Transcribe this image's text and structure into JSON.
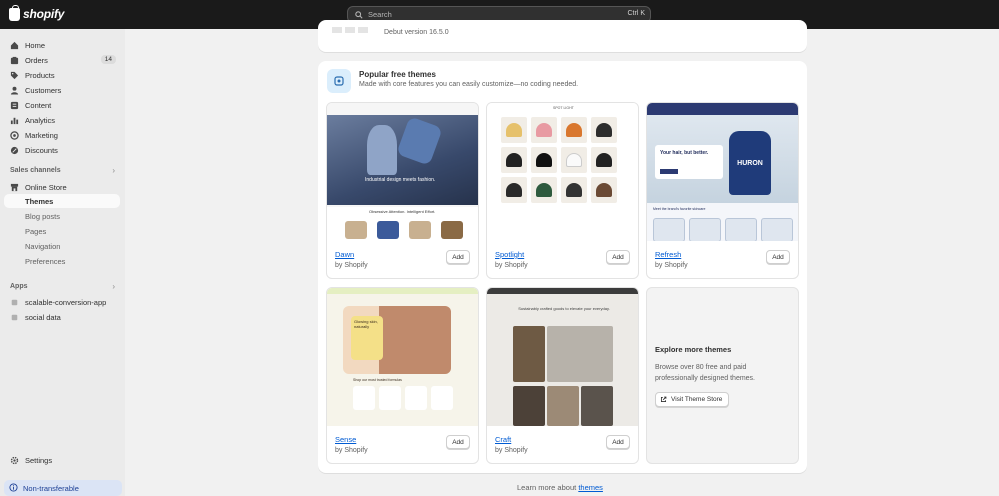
{
  "topbar": {
    "brand": "shopify",
    "search_placeholder": "Search",
    "search_shortcut": "Ctrl K"
  },
  "sidebar": {
    "items": [
      {
        "label": "Home",
        "icon": "home-icon"
      },
      {
        "label": "Orders",
        "icon": "orders-icon",
        "badge": "14"
      },
      {
        "label": "Products",
        "icon": "tag-icon"
      },
      {
        "label": "Customers",
        "icon": "person-icon"
      },
      {
        "label": "Content",
        "icon": "content-icon"
      },
      {
        "label": "Analytics",
        "icon": "chart-icon"
      },
      {
        "label": "Marketing",
        "icon": "target-icon"
      },
      {
        "label": "Discounts",
        "icon": "discount-icon"
      }
    ],
    "sales_channels_label": "Sales channels",
    "online_store": "Online Store",
    "sub_items": [
      "Themes",
      "Blog posts",
      "Pages",
      "Navigation",
      "Preferences"
    ],
    "apps_label": "Apps",
    "apps": [
      "scalable-conversion-app",
      "social data"
    ],
    "settings": "Settings",
    "non_transferable": "Non-transferable"
  },
  "current_theme": {
    "version": "Debut version 16.5.0"
  },
  "popular": {
    "title": "Popular free themes",
    "subtitle": "Made with core features you can easily customize—no coding needed.",
    "add_label": "Add",
    "by_label": "by Shopify",
    "themes": [
      {
        "name": "Dawn",
        "preview_text": "Industrial design meets fashion.",
        "strip_text": "Obsessive Attention. Intelligent Effort."
      },
      {
        "name": "Spotlight",
        "preview_text": "SPOT LIGHT"
      },
      {
        "name": "Refresh",
        "preview_text": "Your hair, but better.",
        "bottle_text": "HURON",
        "section_text": "Meet the brand's favorite skincare"
      },
      {
        "name": "Sense",
        "preview_text": "Glowing skin, naturally",
        "section_text": "Shop our most trusted formulas"
      },
      {
        "name": "Craft",
        "preview_text": "Sustainably crafted goods to elevate your everyday."
      }
    ],
    "explore": {
      "title": "Explore more themes",
      "description": "Browse over 80 free and paid professionally designed themes.",
      "button": "Visit Theme Store"
    }
  },
  "footer": {
    "learn_prefix": "Learn more about",
    "learn_link": "themes"
  }
}
